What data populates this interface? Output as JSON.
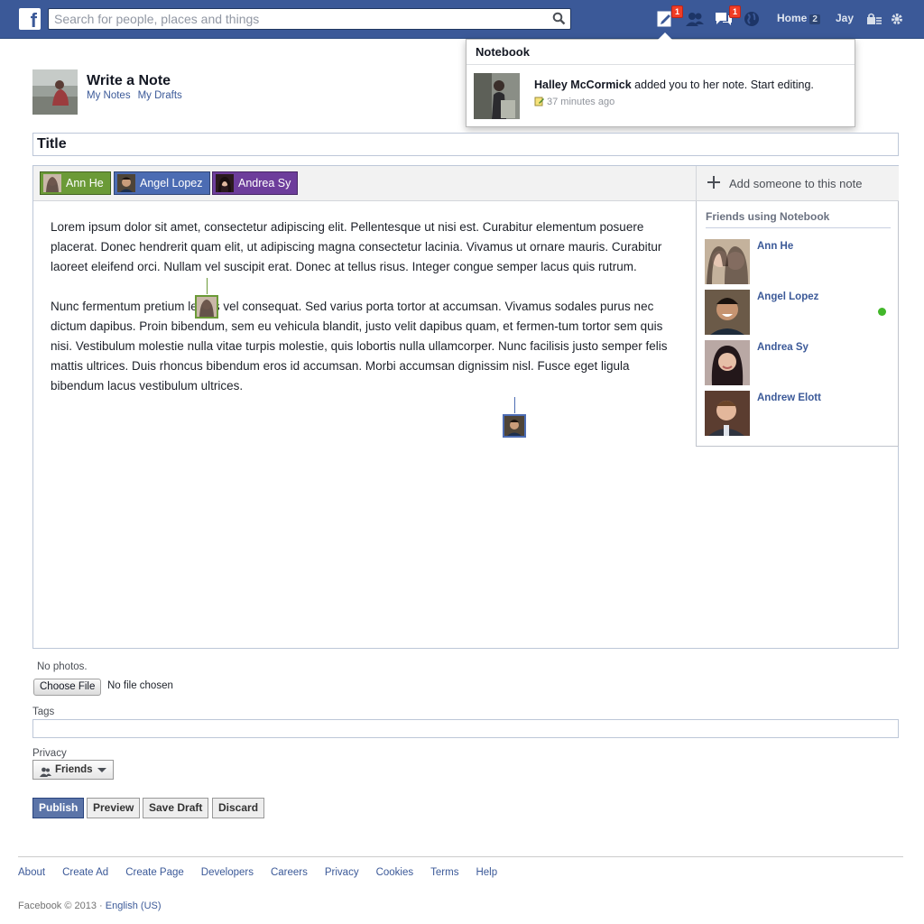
{
  "topbar": {
    "logo": "f",
    "search_placeholder": "Search for people, places and things",
    "notes_badge": "1",
    "messages_badge": "1",
    "home_label": "Home",
    "home_count": "2",
    "user_label": "Jay"
  },
  "flyout": {
    "title": "Notebook",
    "actor": "Halley McCormick",
    "message": " added you to her note. Start editing.",
    "time": "37 minutes ago"
  },
  "header": {
    "title": "Write a Note",
    "links": [
      "My Notes",
      "My Drafts"
    ]
  },
  "note": {
    "title_placeholder": "Title",
    "collaborators": [
      {
        "name": "Ann He",
        "color": "#6b9a37"
      },
      {
        "name": "Angel Lopez",
        "color": "#4c6cb3"
      },
      {
        "name": "Andrea Sy",
        "color": "#6d3d9b"
      }
    ],
    "add_label": "Add someone to this note",
    "paragraphs": [
      "Lorem ipsum dolor sit amet, consectetur adipiscing elit. Pellentesque ut nisi est. Curabitur elementum posuere placerat. Donec hendrerit quam elit, ut adipiscing magna consectetur lacinia. Vivamus ut ornare mauris. Curabitur laoreet eleifend orci. Nullam vel suscipit erat. Donec at tellus risus. Integer congue semper lacus quis rutrum.",
      "Nunc fermentum pretium lectus vel consequat. Sed varius porta tortor at accumsan. Vivamus sodales purus nec dictum dapibus. Proin bibendum, sem eu vehicula blandit, justo velit dapibus quam, et fermen-tum tortor sem quis nisi. Vestibulum molestie nulla vitae turpis molestie, quis lobortis nulla ullamcorper. Nunc facilisis justo semper felis mattis ultrices. Duis rhoncus bibendum eros id accumsan. Morbi accumsan dignissim nisl. Fusce eget ligula bibendum lacus vestibulum ultrices."
    ]
  },
  "friends_panel": {
    "title": "Friends using Notebook",
    "friends": [
      {
        "name": "Ann He",
        "online": false
      },
      {
        "name": "Angel Lopez",
        "online": true
      },
      {
        "name": "Andrea Sy",
        "online": false
      },
      {
        "name": "Andrew Elott",
        "online": false
      }
    ]
  },
  "form": {
    "no_photos": "No photos.",
    "choose_file": "Choose File",
    "file_status": "No file chosen",
    "tags_label": "Tags",
    "privacy_label": "Privacy",
    "privacy_value": "Friends",
    "buttons": {
      "publish": "Publish",
      "preview": "Preview",
      "save_draft": "Save Draft",
      "discard": "Discard"
    }
  },
  "footer": {
    "links": [
      "About",
      "Create Ad",
      "Create Page",
      "Developers",
      "Careers",
      "Privacy",
      "Cookies",
      "Terms",
      "Help"
    ],
    "copyright": "Facebook © 2013 · ",
    "language": "English (US)"
  },
  "colors": {
    "brand": "#3b5998",
    "online": "#42b72a",
    "badge": "#f03d25"
  }
}
